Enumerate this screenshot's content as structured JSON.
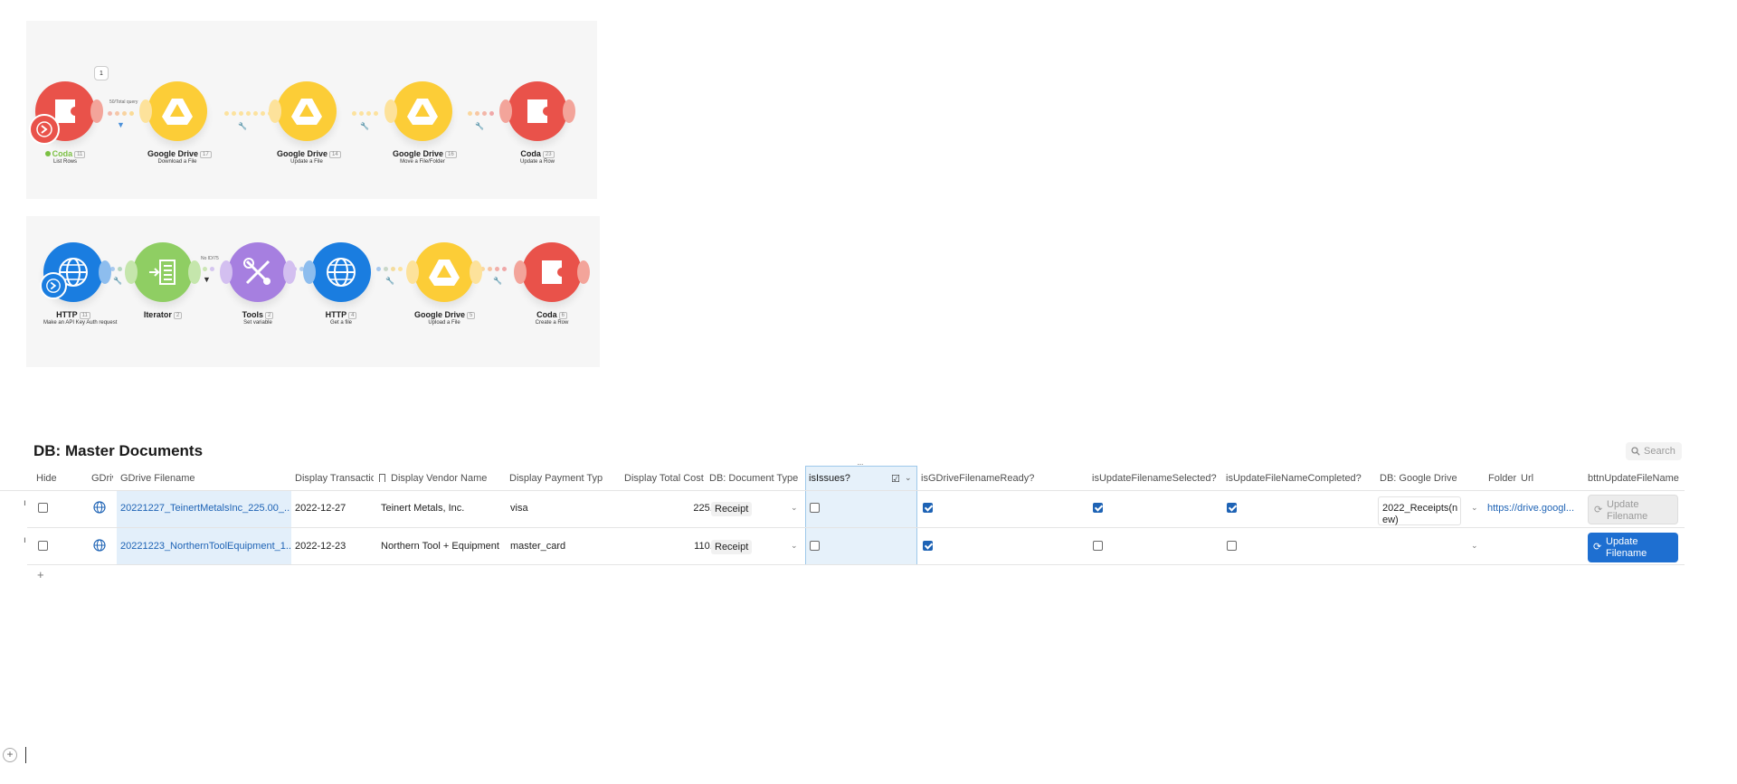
{
  "scenario_top": {
    "badge_count": "1",
    "route_label": "50/Total query",
    "nodes": [
      {
        "name": "Coda",
        "num": "11",
        "desc": "List Rows",
        "color": "#e9524a",
        "icon": "coda-icon"
      },
      {
        "name": "Google Drive",
        "num": "17",
        "desc": "Download a File",
        "color": "#fccd37",
        "icon": "google-drive-icon"
      },
      {
        "name": "Google Drive",
        "num": "14",
        "desc": "Update a File",
        "color": "#fccd37",
        "icon": "google-drive-icon"
      },
      {
        "name": "Google Drive",
        "num": "16",
        "desc": "Move a File/Folder",
        "color": "#fccd37",
        "icon": "google-drive-icon"
      },
      {
        "name": "Coda",
        "num": "23",
        "desc": "Update a Row",
        "color": "#e9524a",
        "icon": "coda-icon"
      }
    ]
  },
  "scenario_bottom": {
    "route_label": "No ID/75",
    "nodes": [
      {
        "name": "HTTP",
        "num": "11",
        "desc": "Make an API Key Auth request",
        "color": "#1a7de0",
        "icon": "globe-icon"
      },
      {
        "name": "Iterator",
        "num": "2",
        "desc": "",
        "color": "#8fce63",
        "icon": "iterator-icon"
      },
      {
        "name": "Tools",
        "num": "2",
        "desc": "Set variable",
        "color": "#a67fe0",
        "icon": "tools-icon"
      },
      {
        "name": "HTTP",
        "num": "4",
        "desc": "Get a file",
        "color": "#1a7de0",
        "icon": "globe-icon"
      },
      {
        "name": "Google Drive",
        "num": "5",
        "desc": "Upload a File",
        "color": "#fccd37",
        "icon": "google-drive-icon"
      },
      {
        "name": "Coda",
        "num": "6",
        "desc": "Create a Row",
        "color": "#e9524a",
        "icon": "coda-icon"
      }
    ]
  },
  "doc": {
    "title": "DB: Master Documents",
    "search_placeholder": "Search"
  },
  "table": {
    "columns": {
      "hide": "Hide",
      "gdrive": "GDriv",
      "gdrive_filename": "GDrive Filename",
      "display_transaction": "Display Transactic",
      "display_vendor": "Display Vendor Name",
      "display_payment": "Display Payment Typ",
      "display_total": "Display Total Cost",
      "doc_type": "DB: Document Type",
      "is_issues": "isIssues?",
      "is_ready": "isGDriveFilenameReady?",
      "is_selected": "isUpdateFilenameSelected?",
      "is_completed": "isUpdateFileNameCompleted?",
      "google_drive": "DB: Google Drive",
      "folder": "Folder",
      "url": "Url",
      "bttn": "bttnUpdateFileName"
    },
    "rows": [
      {
        "filename": "20221227_TeinertMetalsInc_225.00_...",
        "date": "2022-12-27",
        "vendor": "Teinert Metals, Inc.",
        "payment": "visa",
        "total": "225.00",
        "doc_type": "Receipt",
        "hide": false,
        "is_issues": false,
        "is_ready": true,
        "is_selected": true,
        "is_completed": true,
        "google_drive_line1": "2022_Receipts(n",
        "google_drive_line2": "ew)",
        "url": "https://drive.googl...",
        "button_line1": "Update",
        "button_line2": "Filename",
        "button_enabled": false
      },
      {
        "filename": "20221223_NorthernToolEquipment_1...",
        "date": "2022-12-23",
        "vendor": "Northern Tool + Equipment",
        "payment": "master_card",
        "total": "110.36",
        "doc_type": "Receipt",
        "hide": false,
        "is_issues": false,
        "is_ready": true,
        "is_selected": false,
        "is_completed": false,
        "google_drive_line1": "",
        "google_drive_line2": "",
        "url": "",
        "button_line1": "Update",
        "button_line2": "Filename",
        "button_enabled": true
      }
    ],
    "add_row_symbol": "+"
  },
  "colors": {
    "accent": "#1e63b5",
    "button_primary": "#1e6fd1",
    "highlight_column": "#e6f1fa"
  }
}
